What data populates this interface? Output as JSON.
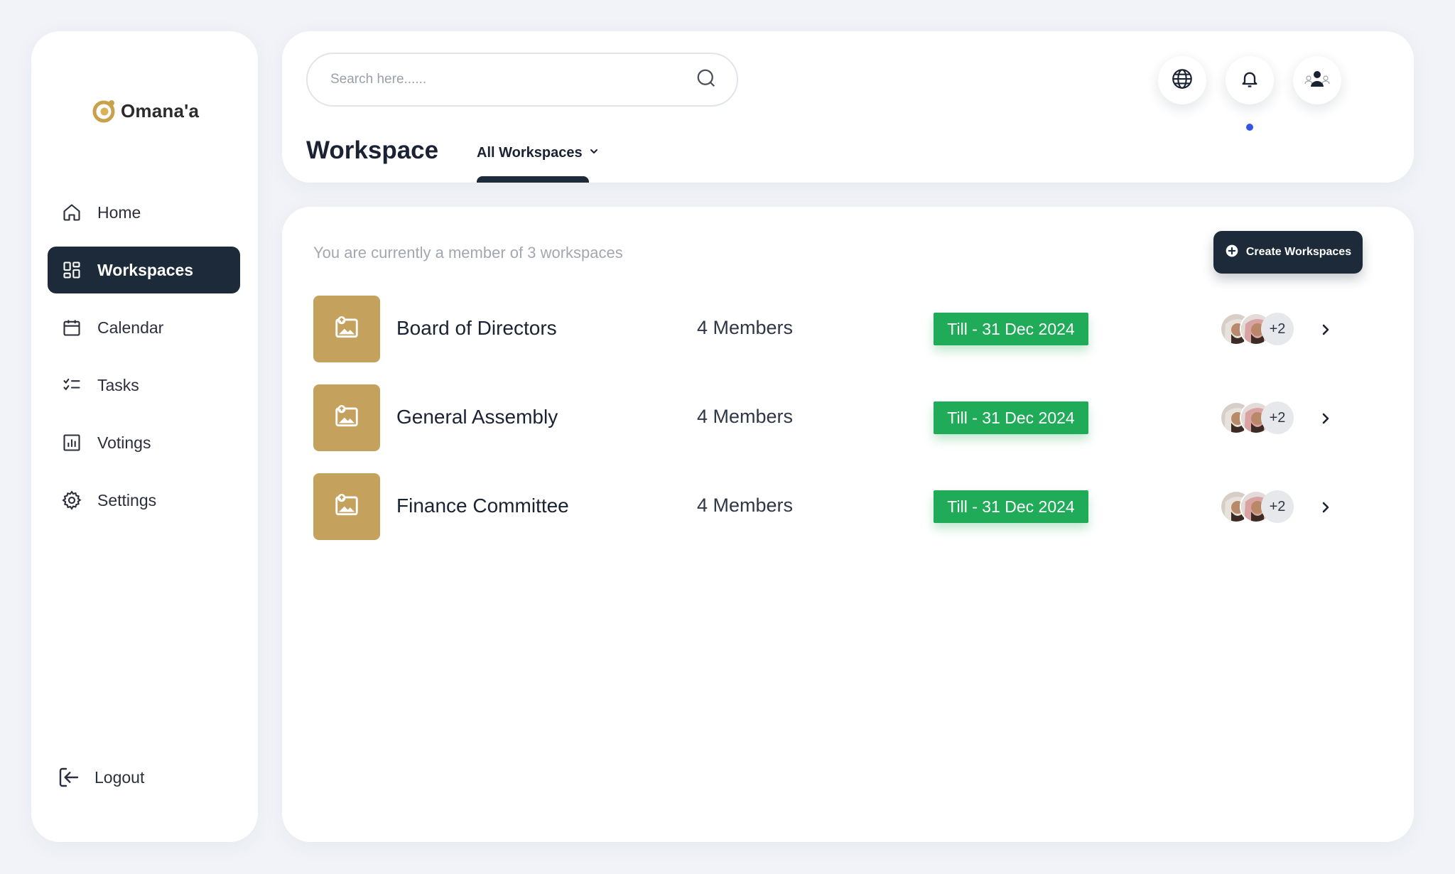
{
  "app": {
    "name": "Omana'a",
    "brand_color": "#c4a15c",
    "dark_color": "#1c2a3a",
    "badge_color": "#1fab57"
  },
  "sidebar": {
    "items": [
      {
        "label": "Home",
        "icon": "home-icon",
        "active": false
      },
      {
        "label": "Workspaces",
        "icon": "grid-icon",
        "active": true
      },
      {
        "label": "Calendar",
        "icon": "calendar-icon",
        "active": false
      },
      {
        "label": "Tasks",
        "icon": "checklist-icon",
        "active": false
      },
      {
        "label": "Votings",
        "icon": "bar-chart-icon",
        "active": false
      },
      {
        "label": "Settings",
        "icon": "gear-icon",
        "active": false
      }
    ],
    "logout_label": "Logout"
  },
  "header": {
    "search_placeholder": "Search here......",
    "page_title": "Workspace",
    "filter_label": "All Workspaces"
  },
  "main": {
    "member_info": "You are currently a member of 3 workspaces",
    "create_label": "Create Workspaces",
    "workspaces": [
      {
        "name": "Board of Directors",
        "members": "4 Members",
        "until": "Till - 31 Dec 2024",
        "extra": "+2"
      },
      {
        "name": "General Assembly",
        "members": "4 Members",
        "until": "Till - 31 Dec 2024",
        "extra": "+2"
      },
      {
        "name": "Finance Committee",
        "members": "4 Members",
        "until": "Till - 31 Dec 2024",
        "extra": "+2"
      }
    ]
  }
}
